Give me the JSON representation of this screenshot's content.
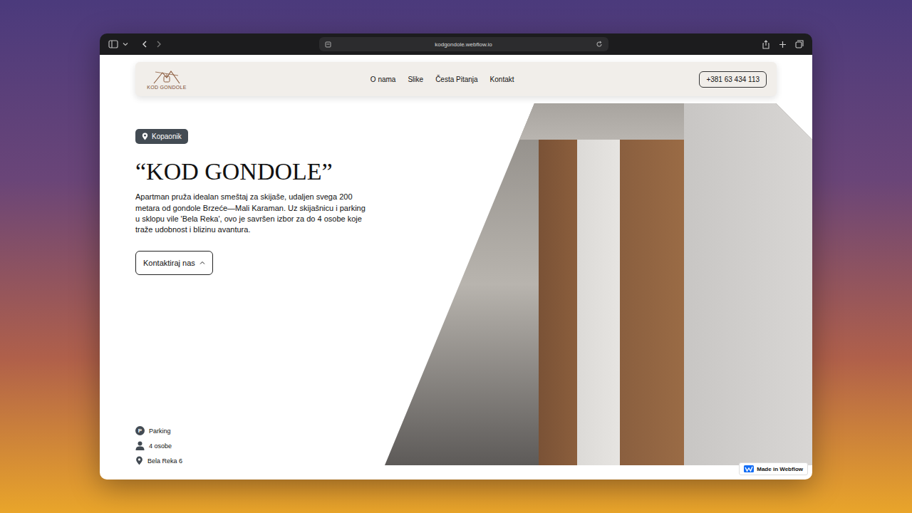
{
  "browser": {
    "url": "kodgondole.webflow.io"
  },
  "nav": {
    "logo": "KOD GONDOLE",
    "links": [
      "O nama",
      "Slike",
      "Česta Pitanja",
      "Kontakt"
    ],
    "phone": "+381 63 434 113"
  },
  "hero": {
    "location": "Kopaonik",
    "title": "“KOD GONDOLE”",
    "description": "Apartman pruža idealan smeštaj za skijaše, udaljen svega 200 metara od gondole Brzeće—Mali Karaman. Uz skijašnicu i parking u sklopu vile 'Bela Reka', ovo je savršen izbor za do 4 osobe koje traže udobnost i blizinu avantura.",
    "cta": "Kontaktiraj nas"
  },
  "features": [
    {
      "kind": "parking",
      "glyph": "P",
      "label": "Parking"
    },
    {
      "kind": "person",
      "label": "4 osobe"
    },
    {
      "kind": "pin",
      "label": "Bela Reka 6"
    }
  ],
  "badge": "Made in Webflow"
}
